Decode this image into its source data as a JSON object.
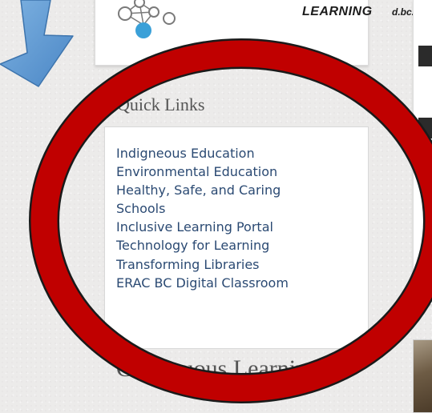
{
  "logo": {
    "word": "LEARNING",
    "url": "d.bc.ca"
  },
  "quick_links": {
    "title": "Quick Links",
    "items": [
      {
        "label": "Indigneous Education"
      },
      {
        "label": "Environmental Education"
      },
      {
        "label": "Healthy, Safe, and Caring"
      },
      {
        "label": "Schools"
      },
      {
        "label": "Inclusive Learning Portal"
      },
      {
        "label": "Technology for Learning"
      },
      {
        "label": "Transforming Libraries"
      },
      {
        "label": "ERAC BC Digital Classroom"
      }
    ]
  },
  "next_section": {
    "title": "Continuous Learning"
  },
  "annotations": {
    "arrow_icon": "down-right-arrow-icon",
    "arrow_color": "#5b9bd5",
    "circle_color": "#c00000",
    "circle_stroke_color": "#1a1a1a"
  },
  "colors": {
    "link": "#2b4a73",
    "heading": "#555555",
    "logo_blue": "#3aa0d8"
  }
}
